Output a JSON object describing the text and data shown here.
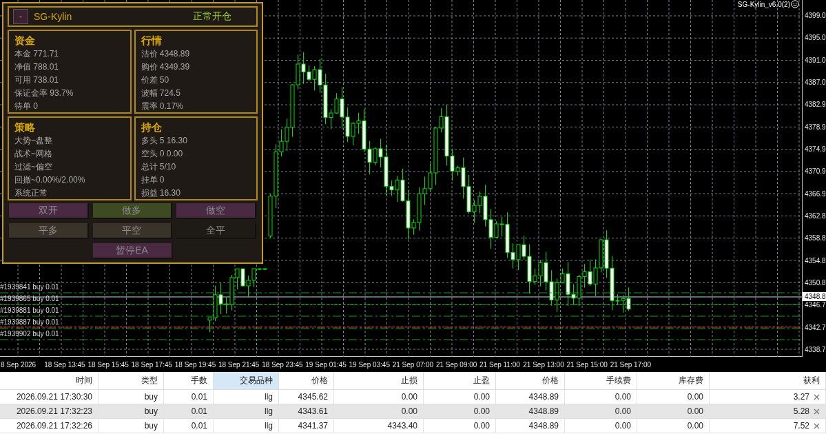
{
  "chart": {
    "indicator_label": "SG-Kylin_v6.0(2)",
    "price_axis": [
      "4399.0",
      "4395.0",
      "4391.0",
      "4387.0",
      "4382.9",
      "4378.9",
      "4374.9",
      "4370.9",
      "4366.9",
      "4362.8",
      "4358.8",
      "4354.8",
      "4350.8",
      "4346.7",
      "4342.7",
      "4338.7"
    ],
    "current_price": "4348.8",
    "order_lines": [
      {
        "label": "#1939841 buy 0.01",
        "stop_loss": false
      },
      {
        "label": "#1939865 buy 0.01",
        "stop_loss": false
      },
      {
        "label": "#1939881 buy 0.01",
        "stop_loss": false
      },
      {
        "label": "#1939887 buy 0.01",
        "stop_loss": true
      },
      {
        "label": "#1939902 buy 0.01",
        "stop_loss": false
      }
    ],
    "time_axis": [
      "8 Sep 2026",
      "18 Sep 13:45",
      "18 Sep 15:45",
      "18 Sep 17:45",
      "18 Sep 19:45",
      "18 Sep 21:45",
      "18 Sep 23:45",
      "19 Sep 01:45",
      "19 Sep 03:45",
      "21 Sep 07:00",
      "21 Sep 09:00",
      "21 Sep 11:00",
      "21 Sep 13:00",
      "21 Sep 15:00",
      "21 Sep 17:00"
    ]
  },
  "panel": {
    "collapse_button": "-",
    "title": "SG-Kylin",
    "status": "正常开仓",
    "sections": [
      {
        "title": "资金",
        "lines": [
          "本金 771.71",
          "净值 788.01",
          "可用 738.01",
          "保证金率 93.7%",
          "待单 0"
        ]
      },
      {
        "title": "行情",
        "lines": [
          "沽价 4348.89",
          "购价 4349.39",
          "价差 50",
          "波幅 724.5",
          "震率 0.17%"
        ]
      },
      {
        "title": "策略",
        "lines": [
          "大势~盘整",
          "战术~网格",
          "过滤~偏空",
          "回撤~0.00%/2.00%",
          "系统正常"
        ]
      },
      {
        "title": "持仓",
        "lines": [
          "多头 5 16.30",
          "空头 0 0.00",
          "总计 5/10",
          "挂单 0",
          "损益 16.30"
        ]
      }
    ],
    "buttons": [
      {
        "label": "双开",
        "color": "#4a2a42"
      },
      {
        "label": "做多",
        "color": "#3e4a22"
      },
      {
        "label": "做空",
        "color": "#4a2a42"
      },
      {
        "label": "平多",
        "color": "#3a332a"
      },
      {
        "label": "平空",
        "color": "#3a332a"
      },
      {
        "label": "全平",
        "color": "#1e1a16"
      },
      {
        "label": "暂停EA",
        "color": "#4a2a42"
      }
    ]
  },
  "trades_table": {
    "columns": [
      {
        "label": "时间",
        "selected": false
      },
      {
        "label": "类型",
        "selected": false
      },
      {
        "label": "手数",
        "selected": false
      },
      {
        "label": "交易品种",
        "selected": true
      },
      {
        "label": "价格",
        "selected": false
      },
      {
        "label": "止损",
        "selected": false
      },
      {
        "label": "止盈",
        "selected": false
      },
      {
        "label": "价格",
        "selected": false
      },
      {
        "label": "手续费",
        "selected": false
      },
      {
        "label": "库存费",
        "selected": false
      },
      {
        "label": "获利",
        "selected": false
      }
    ],
    "rows": [
      {
        "selected": false,
        "cells": [
          "2026.09.21 17:30:30",
          "buy",
          "0.01",
          "llg",
          "4345.62",
          "0.00",
          "0.00",
          "4348.89",
          "0.00",
          "0.00",
          "3.27"
        ]
      },
      {
        "selected": true,
        "cells": [
          "2026.09.21 17:32:23",
          "buy",
          "0.01",
          "llg",
          "4343.61",
          "0.00",
          "0.00",
          "4348.89",
          "0.00",
          "0.00",
          "5.28"
        ]
      },
      {
        "selected": false,
        "cells": [
          "2026.09.21 17:32:26",
          "buy",
          "0.01",
          "llg",
          "4341.37",
          "4343.40",
          "0.00",
          "4348.89",
          "0.00",
          "0.00",
          "7.52"
        ]
      }
    ]
  }
}
